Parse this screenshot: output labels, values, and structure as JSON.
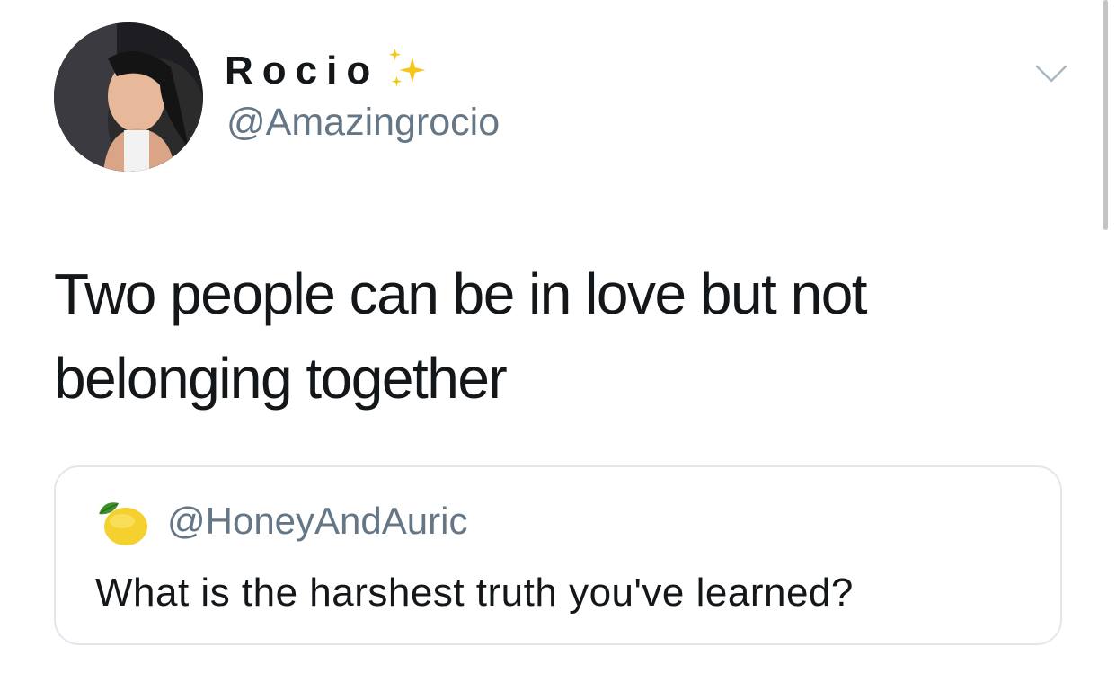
{
  "author": {
    "display_name": "Rocio",
    "handle": "@Amazingrocio",
    "avatar_icon": "profile-photo",
    "name_emoji_icon": "sparkles-icon"
  },
  "tweet": {
    "text": "Two people can be in love but not belonging together"
  },
  "quoted_tweet": {
    "emoji_icon": "lemon-icon",
    "handle": "@HoneyAndAuric",
    "text": "What is the harshest truth you've learned?"
  },
  "menu_icon": "chevron-down-icon",
  "colors": {
    "text_primary": "#14171a",
    "text_secondary": "#657786",
    "border": "#e1e8ed",
    "sparkle": "#f5c518"
  }
}
